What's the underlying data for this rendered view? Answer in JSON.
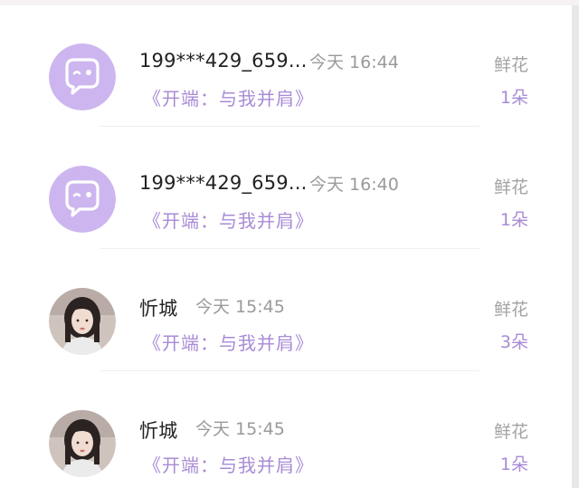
{
  "records": [
    {
      "user": "199***429_659...",
      "time": "今天 16:44",
      "work": "《开端：与我并肩》",
      "gift_name": "鲜花",
      "gift_count": "1朵",
      "avatar": "default-avatar"
    },
    {
      "user": "199***429_659...",
      "time": "今天 16:40",
      "work": "《开端：与我并肩》",
      "gift_name": "鲜花",
      "gift_count": "1朵",
      "avatar": "default-avatar"
    },
    {
      "user": "忻城",
      "time": "今天 15:45",
      "work": "《开端：与我并肩》",
      "gift_name": "鲜花",
      "gift_count": "3朵",
      "avatar": "photo-avatar"
    },
    {
      "user": "忻城",
      "time": "今天 15:45",
      "work": "《开端：与我并肩》",
      "gift_name": "鲜花",
      "gift_count": "1朵",
      "avatar": "photo-avatar"
    }
  ],
  "colors": {
    "accent": "#a88bd6",
    "avatar_bg": "#cdb6ef"
  }
}
